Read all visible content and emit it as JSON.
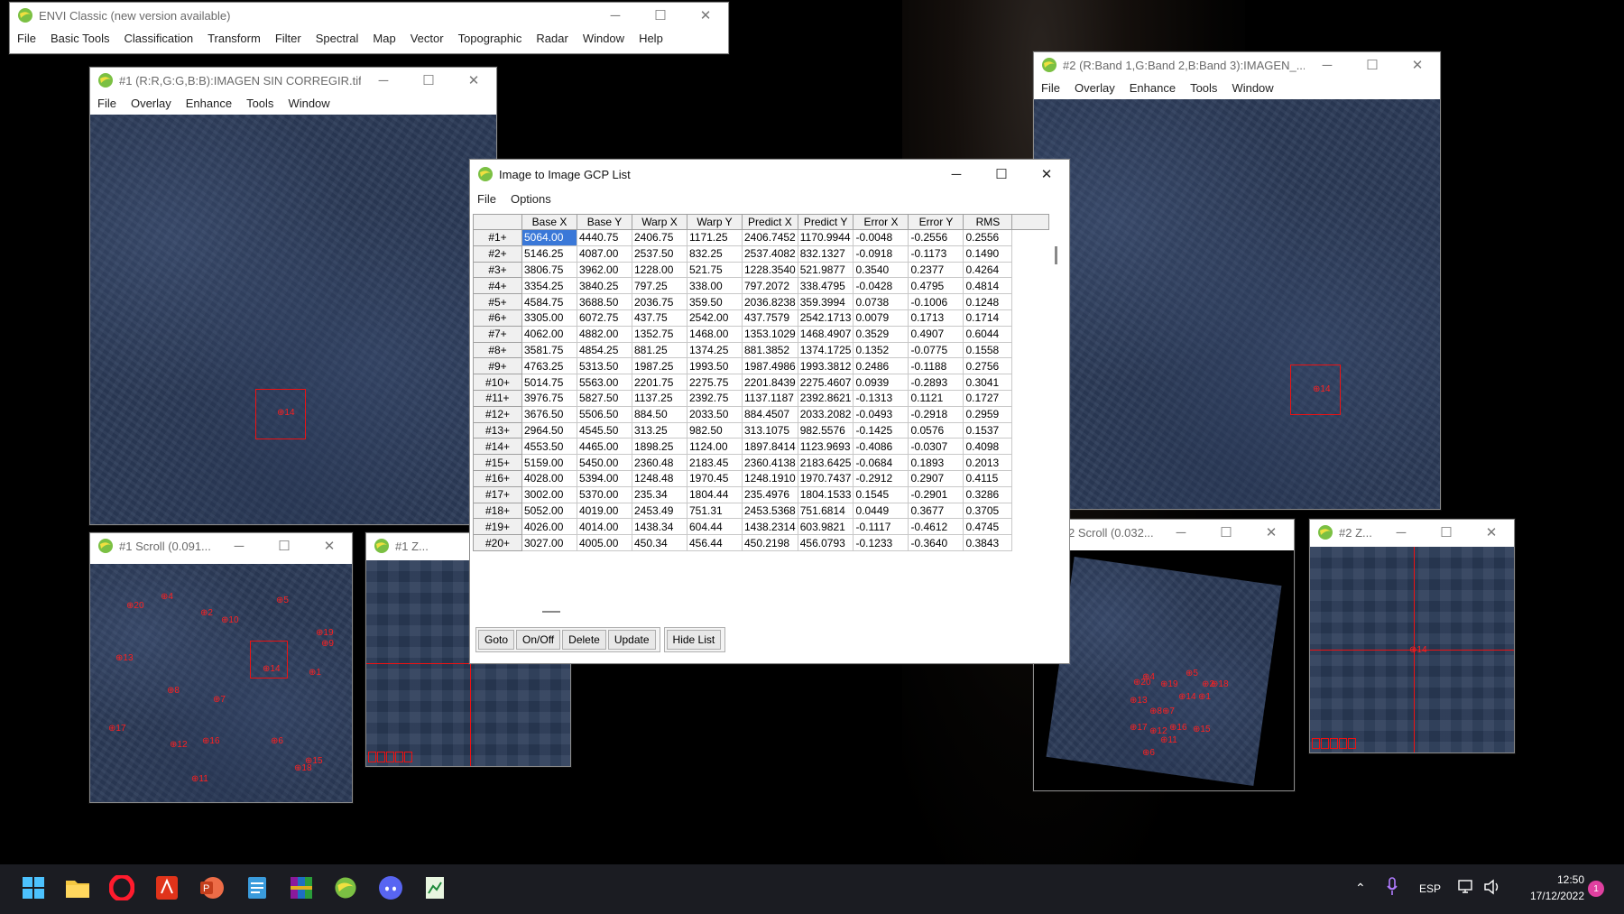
{
  "colors": {
    "gcp_red": "#ff2020",
    "selection_blue": "#3a78d8",
    "taskbar": "#1b1c22"
  },
  "main_window": {
    "title": "ENVI Classic (new version available)",
    "menu": [
      "File",
      "Basic Tools",
      "Classification",
      "Transform",
      "Filter",
      "Spectral",
      "Map",
      "Vector",
      "Topographic",
      "Radar",
      "Window",
      "Help"
    ]
  },
  "image1": {
    "title": "#1 (R:R,G:G,B:B):IMAGEN SIN CORREGIR.tif",
    "menu": [
      "File",
      "Overlay",
      "Enhance",
      "Tools",
      "Window"
    ],
    "marker": "⊕14"
  },
  "image2": {
    "title": "#2 (R:Band 1,G:Band 2,B:Band 3):IMAGEN_...",
    "menu": [
      "File",
      "Overlay",
      "Enhance",
      "Tools",
      "Window"
    ],
    "marker": "⊕14"
  },
  "scroll1": {
    "title": "#1 Scroll (0.091...",
    "markers": [
      "⊕20",
      "⊕4",
      "⊕5",
      "⊕2",
      "⊕10",
      "⊕19",
      "⊕9",
      "⊕13",
      "⊕14",
      "⊕1",
      "⊕8",
      "⊕7",
      "⊕17",
      "⊕12",
      "⊕16",
      "⊕6",
      "⊕15",
      "⊕18",
      "⊕11"
    ]
  },
  "zoom1": {
    "title": "#1 Z..."
  },
  "scroll2": {
    "title": "2 Scroll (0.032...",
    "markers": [
      "⊕5",
      "⊕20",
      "⊕4",
      "⊕19",
      "⊕2",
      "⊕18",
      "⊕14",
      "⊕1",
      "⊕13",
      "⊕8",
      "⊕7",
      "⊕17",
      "⊕12",
      "⊕16",
      "⊕15",
      "⊕11",
      "⊕6"
    ]
  },
  "zoom2": {
    "title": "#2 Z...",
    "marker": "⊕14"
  },
  "gcp_list": {
    "title": "Image to Image GCP List",
    "menu": [
      "File",
      "Options"
    ],
    "columns": [
      "Base X",
      "Base Y",
      "Warp X",
      "Warp Y",
      "Predict X",
      "Predict Y",
      "Error X",
      "Error Y",
      "RMS"
    ],
    "rows": [
      [
        "#1+",
        "5064.00",
        "4440.75",
        "2406.75",
        "1171.25",
        "2406.7452",
        "1170.9944",
        "-0.0048",
        "-0.2556",
        "0.2556"
      ],
      [
        "#2+",
        "5146.25",
        "4087.00",
        "2537.50",
        "832.25",
        "2537.4082",
        "832.1327",
        "-0.0918",
        "-0.1173",
        "0.1490"
      ],
      [
        "#3+",
        "3806.75",
        "3962.00",
        "1228.00",
        "521.75",
        "1228.3540",
        "521.9877",
        "0.3540",
        "0.2377",
        "0.4264"
      ],
      [
        "#4+",
        "3354.25",
        "3840.25",
        "797.25",
        "338.00",
        "797.2072",
        "338.4795",
        "-0.0428",
        "0.4795",
        "0.4814"
      ],
      [
        "#5+",
        "4584.75",
        "3688.50",
        "2036.75",
        "359.50",
        "2036.8238",
        "359.3994",
        "0.0738",
        "-0.1006",
        "0.1248"
      ],
      [
        "#6+",
        "3305.00",
        "6072.75",
        "437.75",
        "2542.00",
        "437.7579",
        "2542.1713",
        "0.0079",
        "0.1713",
        "0.1714"
      ],
      [
        "#7+",
        "4062.00",
        "4882.00",
        "1352.75",
        "1468.00",
        "1353.1029",
        "1468.4907",
        "0.3529",
        "0.4907",
        "0.6044"
      ],
      [
        "#8+",
        "3581.75",
        "4854.25",
        "881.25",
        "1374.25",
        "881.3852",
        "1374.1725",
        "0.1352",
        "-0.0775",
        "0.1558"
      ],
      [
        "#9+",
        "4763.25",
        "5313.50",
        "1987.25",
        "1993.50",
        "1987.4986",
        "1993.3812",
        "0.2486",
        "-0.1188",
        "0.2756"
      ],
      [
        "#10+",
        "5014.75",
        "5563.00",
        "2201.75",
        "2275.75",
        "2201.8439",
        "2275.4607",
        "0.0939",
        "-0.2893",
        "0.3041"
      ],
      [
        "#11+",
        "3976.75",
        "5827.50",
        "1137.25",
        "2392.75",
        "1137.1187",
        "2392.8621",
        "-0.1313",
        "0.1121",
        "0.1727"
      ],
      [
        "#12+",
        "3676.50",
        "5506.50",
        "884.50",
        "2033.50",
        "884.4507",
        "2033.2082",
        "-0.0493",
        "-0.2918",
        "0.2959"
      ],
      [
        "#13+",
        "2964.50",
        "4545.50",
        "313.25",
        "982.50",
        "313.1075",
        "982.5576",
        "-0.1425",
        "0.0576",
        "0.1537"
      ],
      [
        "#14+",
        "4553.50",
        "4465.00",
        "1898.25",
        "1124.00",
        "1897.8414",
        "1123.9693",
        "-0.4086",
        "-0.0307",
        "0.4098"
      ],
      [
        "#15+",
        "5159.00",
        "5450.00",
        "2360.48",
        "2183.45",
        "2360.4138",
        "2183.6425",
        "-0.0684",
        "0.1893",
        "0.2013"
      ],
      [
        "#16+",
        "4028.00",
        "5394.00",
        "1248.48",
        "1970.45",
        "1248.1910",
        "1970.7437",
        "-0.2912",
        "0.2907",
        "0.4115"
      ],
      [
        "#17+",
        "3002.00",
        "5370.00",
        "235.34",
        "1804.44",
        "235.4976",
        "1804.1533",
        "0.1545",
        "-0.2901",
        "0.3286"
      ],
      [
        "#18+",
        "5052.00",
        "4019.00",
        "2453.49",
        "751.31",
        "2453.5368",
        "751.6814",
        "0.0449",
        "0.3677",
        "0.3705"
      ],
      [
        "#19+",
        "4026.00",
        "4014.00",
        "1438.34",
        "604.44",
        "1438.2314",
        "603.9821",
        "-0.1117",
        "-0.4612",
        "0.4745"
      ],
      [
        "#20+",
        "3027.00",
        "4005.00",
        "450.34",
        "456.44",
        "450.2198",
        "456.0793",
        "-0.1233",
        "-0.3640",
        "0.3843"
      ]
    ],
    "buttons": [
      "Goto",
      "On/Off",
      "Delete",
      "Update"
    ],
    "hide_button": "Hide List"
  },
  "taskbar": {
    "apps": [
      "start-icon",
      "file-explorer-icon",
      "opera-icon",
      "acrobat-icon",
      "powerpoint-icon",
      "notepad-icon",
      "winrar-icon",
      "envi-icon",
      "discord-icon",
      "spreadsheet-icon"
    ],
    "lang": "ESP",
    "time": "12:50",
    "date": "17/12/2022",
    "notification_count": "1"
  }
}
